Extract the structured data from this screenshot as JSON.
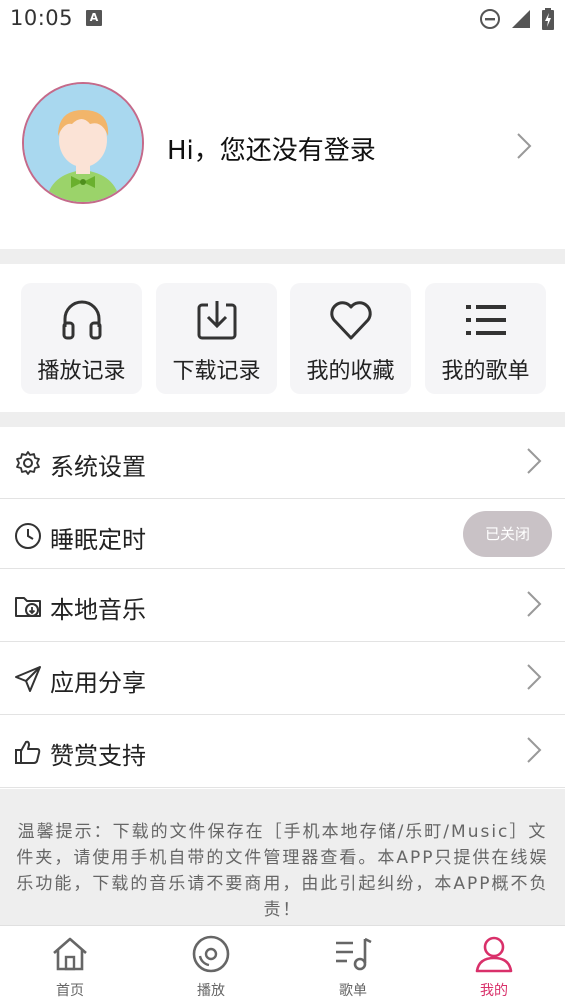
{
  "status_bar": {
    "time": "10:05",
    "notification_icon": "a-notification-icon",
    "icons": [
      "do-not-disturb-icon",
      "signal-icon",
      "battery-charging-icon"
    ]
  },
  "profile": {
    "login_prompt": "Hi，您还没有登录"
  },
  "quick_actions": [
    {
      "label": "播放记录",
      "icon": "headphones-icon"
    },
    {
      "label": "下载记录",
      "icon": "download-icon"
    },
    {
      "label": "我的收藏",
      "icon": "heart-icon"
    },
    {
      "label": "我的歌单",
      "icon": "list-icon"
    }
  ],
  "menu": [
    {
      "label": "系统设置",
      "icon": "gear-icon"
    },
    {
      "label": "睡眠定时",
      "icon": "clock-icon",
      "toggle_label": "已关闭"
    },
    {
      "label": "本地音乐",
      "icon": "folder-download-icon"
    },
    {
      "label": "应用分享",
      "icon": "send-icon"
    },
    {
      "label": "赞赏支持",
      "icon": "thumbs-up-icon"
    }
  ],
  "notice": {
    "text": "温馨提示：下载的文件保存在［手机本地存储/乐町/Music］文件夹，请使用手机自带的文件管理器查看。本APP只提供在线娱乐功能，下载的音乐请不要商用，由此引起纠纷，本APP概不负责！"
  },
  "bottom_nav": {
    "items": [
      {
        "label": "首页",
        "icon": "home-icon"
      },
      {
        "label": "播放",
        "icon": "disc-icon"
      },
      {
        "label": "歌单",
        "icon": "playlist-icon"
      },
      {
        "label": "我的",
        "icon": "user-icon"
      }
    ],
    "active_index": 3
  },
  "colors": {
    "accent": "#d9306a",
    "background_gray": "#eeeeee",
    "tile_background": "#f5f5f7",
    "toggle_off": "#c9c2c6"
  }
}
